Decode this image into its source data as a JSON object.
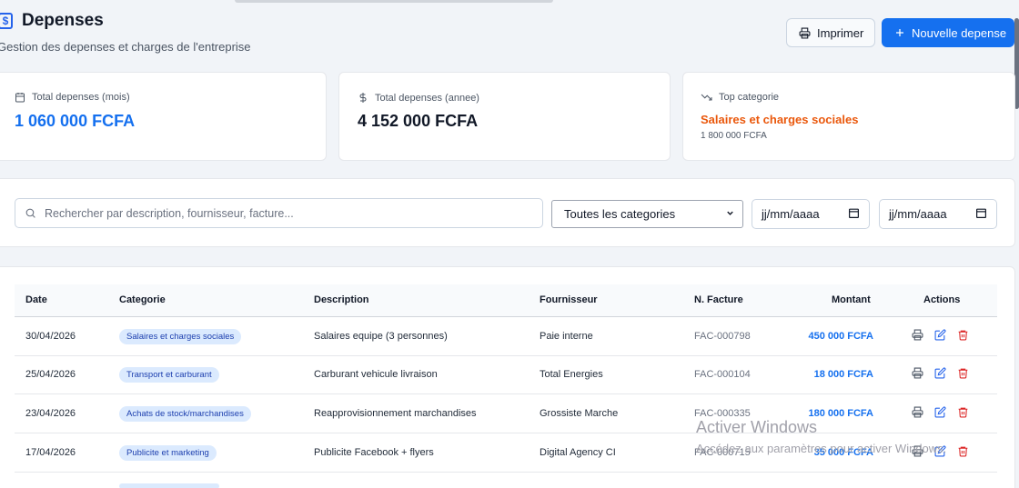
{
  "header": {
    "title": "Depenses",
    "subtitle": "Gestion des depenses et charges de l'entreprise",
    "print_label": "Imprimer",
    "new_label": "Nouvelle depense"
  },
  "stats": {
    "month_label": "Total depenses (mois)",
    "month_value": "1 060 000 FCFA",
    "year_label": "Total depenses (annee)",
    "year_value": "4 152 000 FCFA",
    "top_label": "Top categorie",
    "top_value": "Salaires et charges sociales",
    "top_sub": "1 800 000 FCFA"
  },
  "filters": {
    "search_placeholder": "Rechercher par description, fournisseur, facture...",
    "category_selected": "Toutes les categories",
    "date_from": "jj/mm/aaaa",
    "date_to": "jj/mm/aaaa"
  },
  "table": {
    "headers": {
      "date": "Date",
      "category": "Categorie",
      "description": "Description",
      "supplier": "Fournisseur",
      "invoice": "N. Facture",
      "amount": "Montant",
      "actions": "Actions"
    },
    "rows": [
      {
        "date": "30/04/2026",
        "category": "Salaires et charges sociales",
        "description": "Salaires equipe (3 personnes)",
        "supplier": "Paie interne",
        "invoice": "FAC-000798",
        "amount": "450 000 FCFA"
      },
      {
        "date": "25/04/2026",
        "category": "Transport et carburant",
        "description": "Carburant vehicule livraison",
        "supplier": "Total Energies",
        "invoice": "FAC-000104",
        "amount": "18 000 FCFA"
      },
      {
        "date": "23/04/2026",
        "category": "Achats de stock/marchandises",
        "description": "Reapprovisionnement marchandises",
        "supplier": "Grossiste Marche",
        "invoice": "FAC-000335",
        "amount": "180 000 FCFA"
      },
      {
        "date": "17/04/2026",
        "category": "Publicite et marketing",
        "description": "Publicite Facebook + flyers",
        "supplier": "Digital Agency CI",
        "invoice": "FAC-000715",
        "amount": "35 000 FCFA"
      }
    ]
  },
  "watermark": {
    "title": "Activer Windows",
    "subtitle": "Accédez aux paramètres pour activer Windows."
  },
  "colors": {
    "primary": "#1570ef",
    "accent_orange": "#ea580c",
    "delete_red": "#dc2626",
    "badge_bg": "#dbeafe"
  }
}
